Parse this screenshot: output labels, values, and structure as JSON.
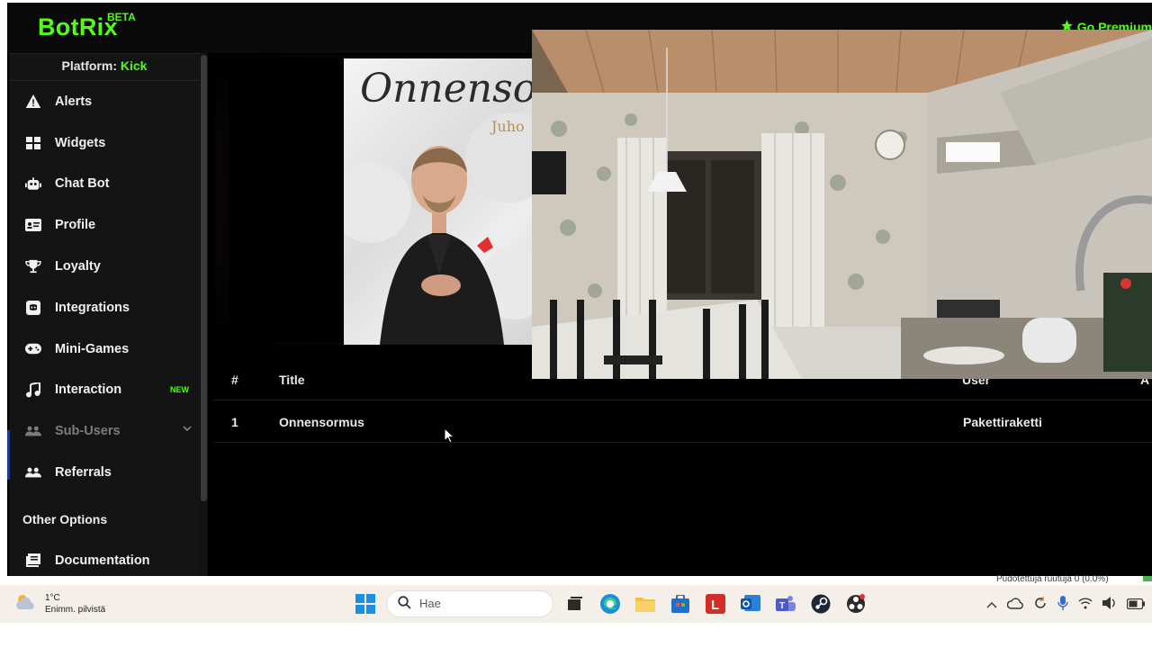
{
  "app": {
    "brand": "BotRix",
    "beta": "BETA",
    "premium": "Go Premium",
    "platform_label": "Platform:",
    "platform_value": "Kick"
  },
  "sidebar": {
    "items": [
      {
        "label": "Alerts",
        "icon": "warning-icon"
      },
      {
        "label": "Widgets",
        "icon": "grid-icon"
      },
      {
        "label": "Chat Bot",
        "icon": "robot-icon"
      },
      {
        "label": "Profile",
        "icon": "id-card-icon"
      },
      {
        "label": "Loyalty",
        "icon": "trophy-icon"
      },
      {
        "label": "Integrations",
        "icon": "discord-icon"
      },
      {
        "label": "Mini-Games",
        "icon": "gamepad-icon"
      },
      {
        "label": "Interaction",
        "icon": "music-icon",
        "badge": "NEW"
      },
      {
        "label": "Sub-Users",
        "icon": "users-icon"
      },
      {
        "label": "Referrals",
        "icon": "users-icon"
      }
    ],
    "section_title": "Other Options",
    "documentation": "Documentation"
  },
  "player": {
    "cover_title": "Onnensor",
    "cover_subtitle": "Juho"
  },
  "table": {
    "headers": {
      "index": "#",
      "title": "Title",
      "user": "User",
      "extra": "A"
    },
    "rows": [
      {
        "index": "1",
        "title": "Onnensormus",
        "user": "Pakettiraketti"
      }
    ]
  },
  "overlay_status": "Pudotettuja ruutuja 0 (0.0%)",
  "taskbar": {
    "temperature": "1°C",
    "weather": "Enimm. pilvistä",
    "search_placeholder": "Hae"
  },
  "colors": {
    "accent": "#53fc18",
    "sidebar_bg": "#141414",
    "content_bg": "#000000",
    "taskbar_bg": "#f4efe9"
  }
}
